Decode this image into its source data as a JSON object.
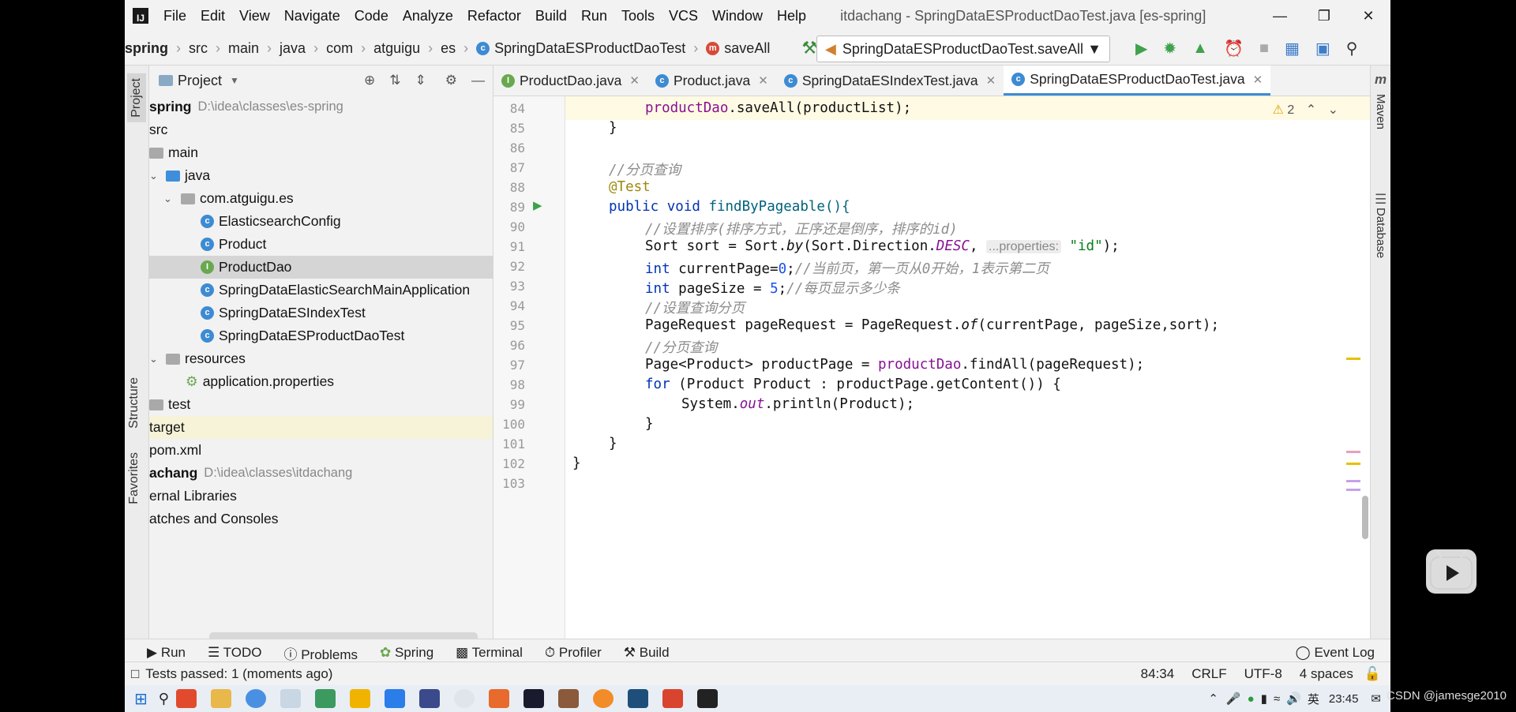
{
  "window": {
    "title": "itdachang - SpringDataESProductDaoTest.java [es-spring]",
    "menu": [
      "File",
      "Edit",
      "View",
      "Navigate",
      "Code",
      "Analyze",
      "Refactor",
      "Build",
      "Run",
      "Tools",
      "VCS",
      "Window",
      "Help"
    ]
  },
  "navbar": {
    "breadcrumbs": [
      "spring",
      "src",
      "main",
      "java",
      "com",
      "atguigu",
      "es",
      "SpringDataESProductDaoTest",
      "saveAll"
    ],
    "run_config": "SpringDataESProductDaoTest.saveAll"
  },
  "project_panel": {
    "title": "Project",
    "items": [
      {
        "label": "spring",
        "path": "D:\\idea\\classes\\es-spring",
        "icon": "module",
        "bold": true
      },
      {
        "label": "src",
        "icon": "folder"
      },
      {
        "label": "main",
        "icon": "folder"
      },
      {
        "label": "java",
        "icon": "source-folder"
      },
      {
        "label": "com.atguigu.es",
        "icon": "package"
      },
      {
        "label": "ElasticsearchConfig",
        "icon": "class"
      },
      {
        "label": "Product",
        "icon": "class"
      },
      {
        "label": "ProductDao",
        "icon": "interface"
      },
      {
        "label": "SpringDataElasticSearchMainApplication",
        "icon": "class"
      },
      {
        "label": "SpringDataESIndexTest",
        "icon": "class"
      },
      {
        "label": "SpringDataESProductDaoTest",
        "icon": "class"
      },
      {
        "label": "resources",
        "icon": "folder"
      },
      {
        "label": "application.properties",
        "icon": "properties"
      },
      {
        "label": "test",
        "icon": "folder"
      },
      {
        "label": "target",
        "icon": "folder"
      },
      {
        "label": "pom.xml",
        "icon": "maven"
      },
      {
        "label": "achang",
        "path": "D:\\idea\\classes\\itdachang",
        "icon": "module",
        "bold": true
      },
      {
        "label": "ernal Libraries",
        "icon": "library"
      },
      {
        "label": "atches and Consoles",
        "icon": "scratch"
      }
    ]
  },
  "left_strip": {
    "project": "Project",
    "structure": "Structure",
    "favorites": "Favorites"
  },
  "right_strip": {
    "maven": "Maven",
    "database": "Database"
  },
  "editor": {
    "tabs": [
      {
        "label": "ProductDao.java",
        "icon": "interface"
      },
      {
        "label": "Product.java",
        "icon": "class"
      },
      {
        "label": "SpringDataESIndexTest.java",
        "icon": "class"
      },
      {
        "label": "SpringDataESProductDaoTest.java",
        "icon": "class",
        "active": true
      }
    ],
    "warnings": "2",
    "lines": [
      "84",
      "85",
      "86",
      "87",
      "88",
      "89",
      "90",
      "91",
      "92",
      "93",
      "94",
      "95",
      "96",
      "97",
      "98",
      "99",
      "100",
      "101",
      "102",
      "103"
    ],
    "code": {
      "l84a": "productDao",
      "l84b": ".saveAll(productList);",
      "l85": "}",
      "l87": "//分页查询",
      "l88": "@Test",
      "l89a": "public void ",
      "l89b": "findByPageable(){",
      "l90": "//设置排序(排序方式，正序还是倒序，排序的id)",
      "l91a": "Sort sort = Sort.",
      "l91b": "by",
      "l91c": "(Sort.Direction.",
      "l91d": "DESC",
      "l91e": ", ",
      "l91hint": "...properties:",
      "l91f": " \"id\"",
      "l91g": ");",
      "l92a": "int ",
      "l92b": "currentPage=",
      "l92c": "0",
      "l92d": ";",
      "l92e": "//当前页，第一页从0开始，1表示第二页",
      "l93a": "int ",
      "l93b": "pageSize = ",
      "l93c": "5",
      "l93d": ";",
      "l93e": "//每页显示多少条",
      "l94": "//设置查询分页",
      "l95a": "PageRequest pageRequest = PageRequest.",
      "l95b": "of",
      "l95c": "(currentPage, pageSize,sort);",
      "l96": "//分页查询",
      "l97a": "Page<Product> productPage = ",
      "l97b": "productDao",
      "l97c": ".findAll(pageRequest);",
      "l98a": "for ",
      "l98b": "(Product Product : productPage.getContent()) {",
      "l99a": "System.",
      "l99b": "out",
      "l99c": ".println(Product);",
      "l100": "}",
      "l101": "}",
      "l102": "}"
    }
  },
  "bottom_tools": [
    "Run",
    "TODO",
    "Problems",
    "Spring",
    "Terminal",
    "Profiler",
    "Build"
  ],
  "event_log": "Event Log",
  "status": {
    "message": "Tests passed: 1 (moments ago)",
    "position": "84:34",
    "line_sep": "CRLF",
    "encoding": "UTF-8",
    "indent": "4 spaces"
  },
  "taskbar": {
    "clock": "23:45",
    "ime": "英"
  },
  "watermark": "CSDN @jamesge2010"
}
